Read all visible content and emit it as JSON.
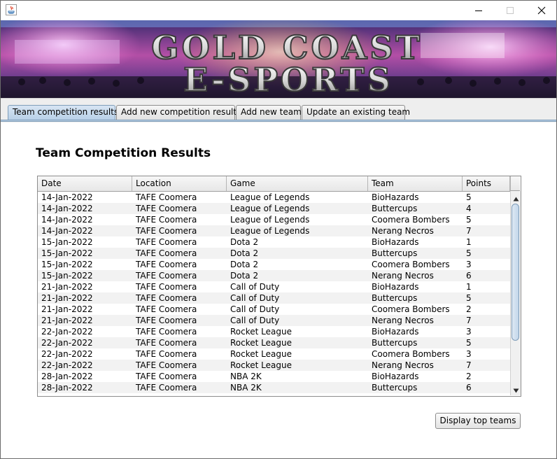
{
  "window": {
    "minimize_icon": "minimize-icon",
    "maximize_icon": "maximize-icon",
    "close_icon": "close-icon"
  },
  "banner": {
    "line1": "GOLD COAST",
    "line2": "E-SPORTS"
  },
  "tabs": [
    {
      "label": "Team competition results",
      "active": true
    },
    {
      "label": "Add new competition results",
      "active": false
    },
    {
      "label": "Add new team",
      "active": false
    },
    {
      "label": "Update an existing team",
      "active": false
    }
  ],
  "heading": "Team Competition Results",
  "table": {
    "columns": [
      "Date",
      "Location",
      "Game",
      "Team",
      "Points"
    ],
    "rows": [
      [
        "14-Jan-2022",
        "TAFE Coomera",
        "League of Legends",
        "BioHazards",
        "5"
      ],
      [
        "14-Jan-2022",
        "TAFE Coomera",
        "League of Legends",
        "Buttercups",
        "4"
      ],
      [
        "14-Jan-2022",
        "TAFE Coomera",
        "League of Legends",
        "Coomera Bombers",
        "5"
      ],
      [
        "14-Jan-2022",
        "TAFE Coomera",
        "League of Legends",
        "Nerang Necros",
        "7"
      ],
      [
        "15-Jan-2022",
        "TAFE Coomera",
        "Dota 2",
        "BioHazards",
        "1"
      ],
      [
        "15-Jan-2022",
        "TAFE Coomera",
        "Dota 2",
        "Buttercups",
        "5"
      ],
      [
        "15-Jan-2022",
        "TAFE Coomera",
        "Dota 2",
        "Coomera Bombers",
        "3"
      ],
      [
        "15-Jan-2022",
        "TAFE Coomera",
        "Dota 2",
        "Nerang Necros",
        "6"
      ],
      [
        "21-Jan-2022",
        "TAFE Coomera",
        "Call of Duty",
        "BioHazards",
        "1"
      ],
      [
        "21-Jan-2022",
        "TAFE Coomera",
        "Call of Duty",
        "Buttercups",
        "5"
      ],
      [
        "21-Jan-2022",
        "TAFE Coomera",
        "Call of Duty",
        "Coomera Bombers",
        "2"
      ],
      [
        "21-Jan-2022",
        "TAFE Coomera",
        "Call of Duty",
        "Nerang Necros",
        "7"
      ],
      [
        "22-Jan-2022",
        "TAFE Coomera",
        "Rocket League",
        "BioHazards",
        "3"
      ],
      [
        "22-Jan-2022",
        "TAFE Coomera",
        "Rocket League",
        "Buttercups",
        "5"
      ],
      [
        "22-Jan-2022",
        "TAFE Coomera",
        "Rocket League",
        "Coomera Bombers",
        "3"
      ],
      [
        "22-Jan-2022",
        "TAFE Coomera",
        "Rocket League",
        "Nerang Necros",
        "7"
      ],
      [
        "28-Jan-2022",
        "TAFE Coomera",
        "NBA 2K",
        "BioHazards",
        "2"
      ],
      [
        "28-Jan-2022",
        "TAFE Coomera",
        "NBA 2K",
        "Buttercups",
        "6"
      ]
    ]
  },
  "button": {
    "label": "Display top teams"
  }
}
